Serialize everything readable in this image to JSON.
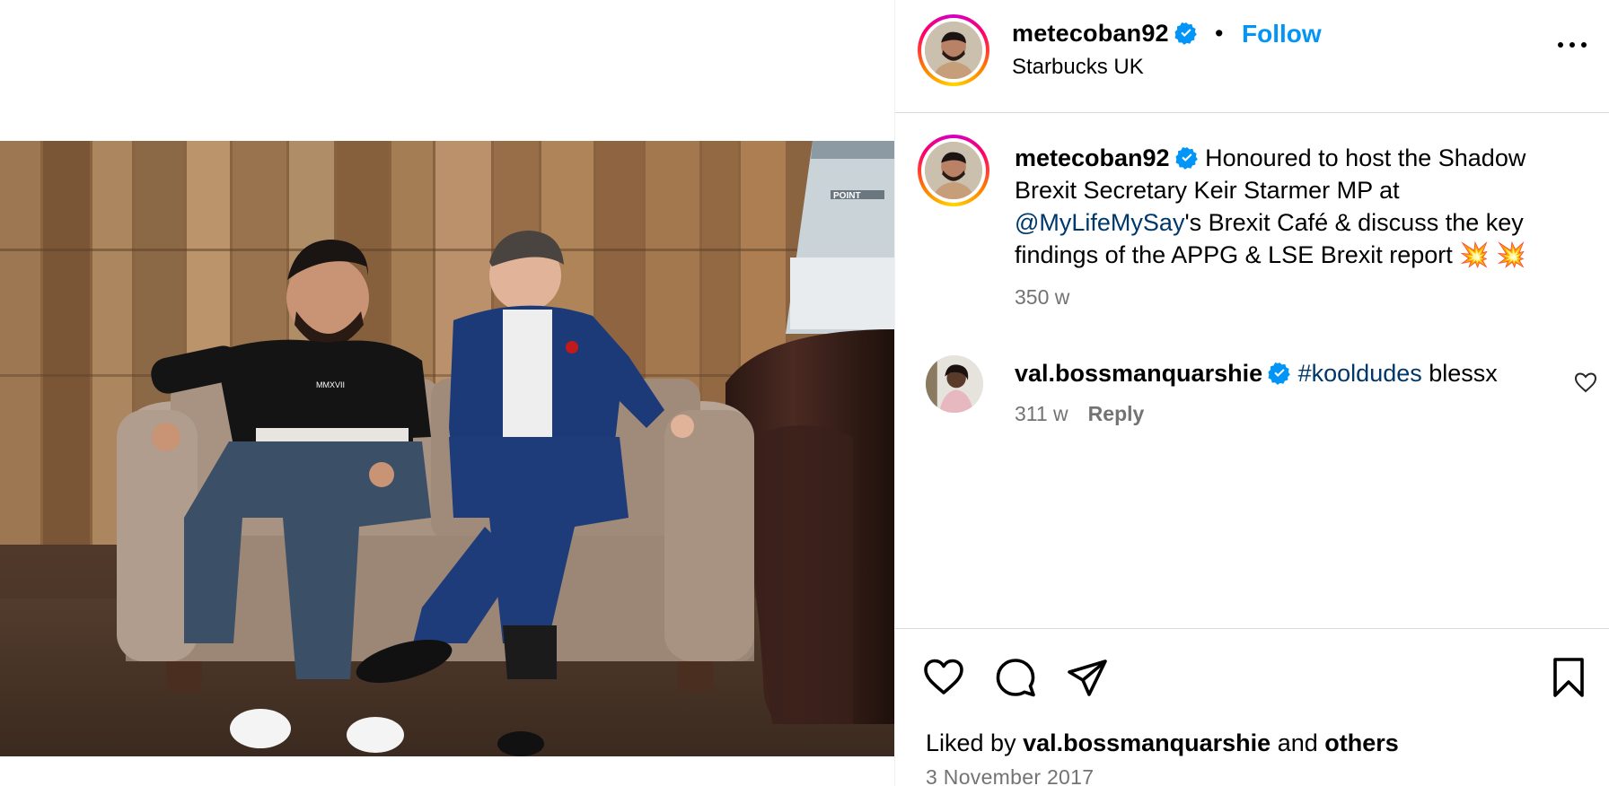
{
  "post": {
    "username": "metecoban92",
    "separator": "•",
    "follow_label": "Follow",
    "location": "Starbucks UK"
  },
  "caption": {
    "username": "metecoban92",
    "text_before": " Honoured to host the Shadow Brexit Secretary Keir Starmer MP at ",
    "mention": "@MyLifeMySay",
    "text_after": "'s Brexit Café & discuss the key findings of the APPG & LSE Brexit report 💥 💥",
    "time": "350 w"
  },
  "comments": [
    {
      "username": "val.bossmanquarshie",
      "hashtag": "#kooldudes",
      "text": " blessx",
      "time": "311 w",
      "reply_label": "Reply"
    }
  ],
  "footer": {
    "liked_prefix": "Liked by ",
    "liked_user": "val.bossmanquarshie",
    "liked_and": " and ",
    "liked_others": "others",
    "date": "3 November 2017"
  },
  "photo": {
    "sweater_text": "MMXVII",
    "window_text": "POINT"
  },
  "icons": {
    "verified": "verified-badge-icon",
    "more": "more-options-icon",
    "like": "heart-icon",
    "comment": "comment-icon",
    "share": "send-icon",
    "save": "bookmark-icon"
  },
  "colors": {
    "link_blue": "#0095f6",
    "mention_blue": "#00376b",
    "muted": "#737373",
    "verified": "#0095f6"
  }
}
